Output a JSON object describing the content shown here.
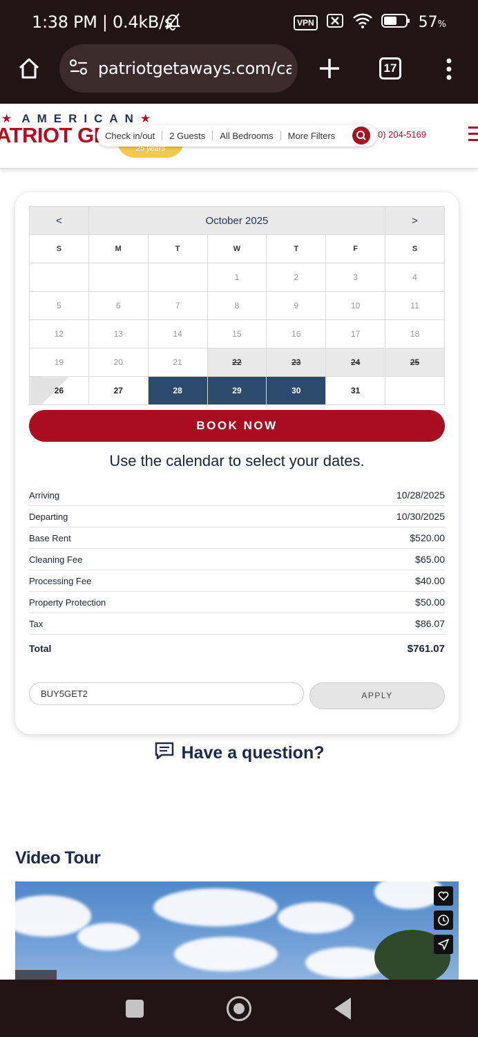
{
  "status_bar": {
    "time": "1:38 PM | 0.4kB/s",
    "vpn": "VPN",
    "battery": "57",
    "battery_unit": "%"
  },
  "browser": {
    "url": "patriotgetaways.com/cab",
    "tab_count": "17"
  },
  "site_header": {
    "brand_top": "AMERICAN",
    "brand_main": "ATRIOT GET",
    "badge": "25 years",
    "filters": [
      "Check in/out",
      "2 Guests",
      "All Bedrooms",
      "More Filters"
    ],
    "phone": "0) 204-5169"
  },
  "calendar": {
    "prev": "<",
    "next": ">",
    "month": "October 2025",
    "day_names": [
      "S",
      "M",
      "T",
      "W",
      "T",
      "F",
      "S"
    ],
    "weeks": [
      [
        {
          "d": "",
          "s": "empty"
        },
        {
          "d": "",
          "s": "empty"
        },
        {
          "d": "",
          "s": "empty"
        },
        {
          "d": "1",
          "s": "past"
        },
        {
          "d": "2",
          "s": "past"
        },
        {
          "d": "3",
          "s": "past"
        },
        {
          "d": "4",
          "s": "past"
        }
      ],
      [
        {
          "d": "5",
          "s": "past"
        },
        {
          "d": "6",
          "s": "past"
        },
        {
          "d": "7",
          "s": "past"
        },
        {
          "d": "8",
          "s": "past"
        },
        {
          "d": "9",
          "s": "past"
        },
        {
          "d": "10",
          "s": "past"
        },
        {
          "d": "11",
          "s": "past"
        }
      ],
      [
        {
          "d": "12",
          "s": "past"
        },
        {
          "d": "13",
          "s": "past"
        },
        {
          "d": "14",
          "s": "past"
        },
        {
          "d": "15",
          "s": "past"
        },
        {
          "d": "16",
          "s": "past"
        },
        {
          "d": "17",
          "s": "past"
        },
        {
          "d": "18",
          "s": "past"
        }
      ],
      [
        {
          "d": "19",
          "s": "past"
        },
        {
          "d": "20",
          "s": "past"
        },
        {
          "d": "21",
          "s": "past"
        },
        {
          "d": "22",
          "s": "booked"
        },
        {
          "d": "23",
          "s": "booked"
        },
        {
          "d": "24",
          "s": "booked"
        },
        {
          "d": "25",
          "s": "booked"
        }
      ],
      [
        {
          "d": "26",
          "s": "half"
        },
        {
          "d": "27",
          "s": "avail"
        },
        {
          "d": "28",
          "s": "sel"
        },
        {
          "d": "29",
          "s": "sel"
        },
        {
          "d": "30",
          "s": "sel"
        },
        {
          "d": "31",
          "s": "avail"
        },
        {
          "d": "",
          "s": "empty"
        }
      ]
    ]
  },
  "book_now": "BOOK NOW",
  "hint": "Use the calendar to select your dates.",
  "costs": [
    {
      "label": "Arriving",
      "value": "10/28/2025"
    },
    {
      "label": "Departing",
      "value": "10/30/2025"
    },
    {
      "label": "Base Rent",
      "value": "$520.00"
    },
    {
      "label": "Cleaning Fee",
      "value": "$65.00"
    },
    {
      "label": "Processing Fee",
      "value": "$40.00"
    },
    {
      "label": "Property Protection",
      "value": "$50.00"
    },
    {
      "label": "Tax",
      "value": "$86.07"
    }
  ],
  "total": {
    "label": "Total",
    "value": "$761.07"
  },
  "promo": {
    "value": "BUY5GET2",
    "apply": "APPLY"
  },
  "question": "Have a question?",
  "video_tour": {
    "title": "Video Tour"
  }
}
